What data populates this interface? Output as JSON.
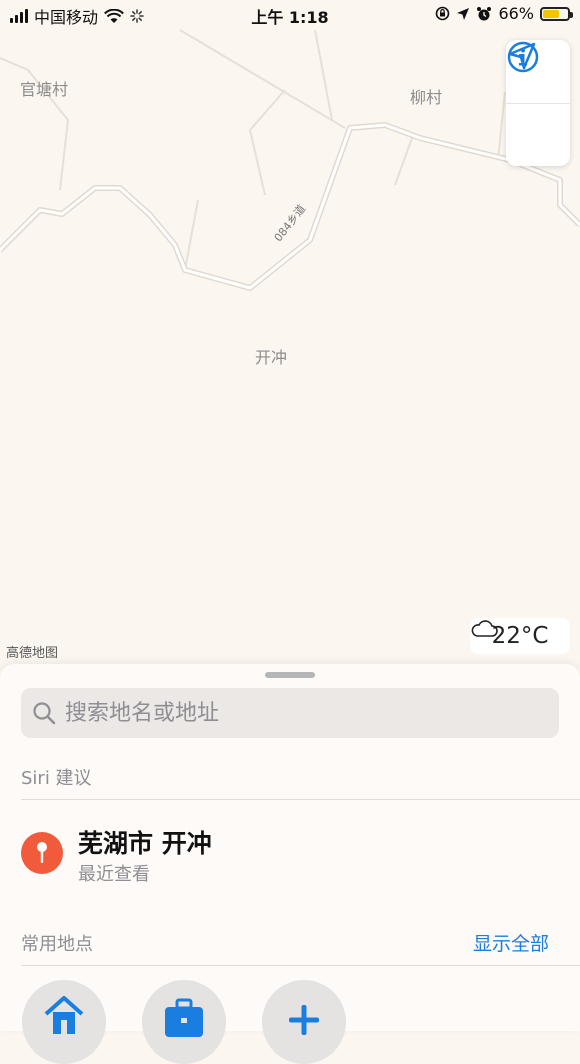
{
  "status_bar": {
    "carrier": "中国移动",
    "time": "上午 1:18",
    "battery_percent": "66%",
    "battery_level": 0.66,
    "icons": [
      "signal-icon",
      "wifi-icon",
      "loading-icon",
      "orientation-lock-icon",
      "location-arrow-icon",
      "alarm-icon",
      "battery-icon"
    ]
  },
  "map": {
    "labels": {
      "guantang": "官塘村",
      "liucun": "柳村",
      "kaichong": "开冲",
      "road": "084乡道"
    },
    "attribution": "高德地图",
    "weather": {
      "temperature": "22°C",
      "icon": "cloud-icon"
    },
    "controls": {
      "info": "info-icon",
      "location": "location-arrow-icon"
    },
    "colors": {
      "background": "#fbf6ef",
      "road": "#ffffff",
      "road_edge": "#e3ddd5",
      "label": "#8c8c8c"
    }
  },
  "sheet": {
    "search_placeholder": "搜索地名或地址",
    "siri_title": "Siri 建议",
    "suggestion": {
      "title": "芜湖市 开冲",
      "subtitle": "最近查看"
    },
    "favorites_title": "常用地点",
    "show_all": "显示全部",
    "favorites": [
      "home-icon",
      "briefcase-icon",
      "plus-icon"
    ],
    "colors": {
      "accent": "#1a7ee0",
      "pin": "#f25a3c"
    }
  }
}
